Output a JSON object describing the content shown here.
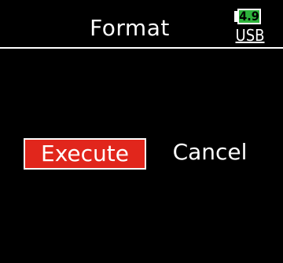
{
  "header": {
    "title": "Format",
    "battery_level": "4.9",
    "power_source": "USB"
  },
  "dialog": {
    "execute_label": "Execute",
    "cancel_label": "Cancel",
    "selected": "Execute"
  },
  "colors": {
    "background": "#000000",
    "text": "#ffffff",
    "selected_button": "#e1261c",
    "battery_fill": "#2db33b"
  },
  "icons": {
    "battery": "battery-icon"
  }
}
